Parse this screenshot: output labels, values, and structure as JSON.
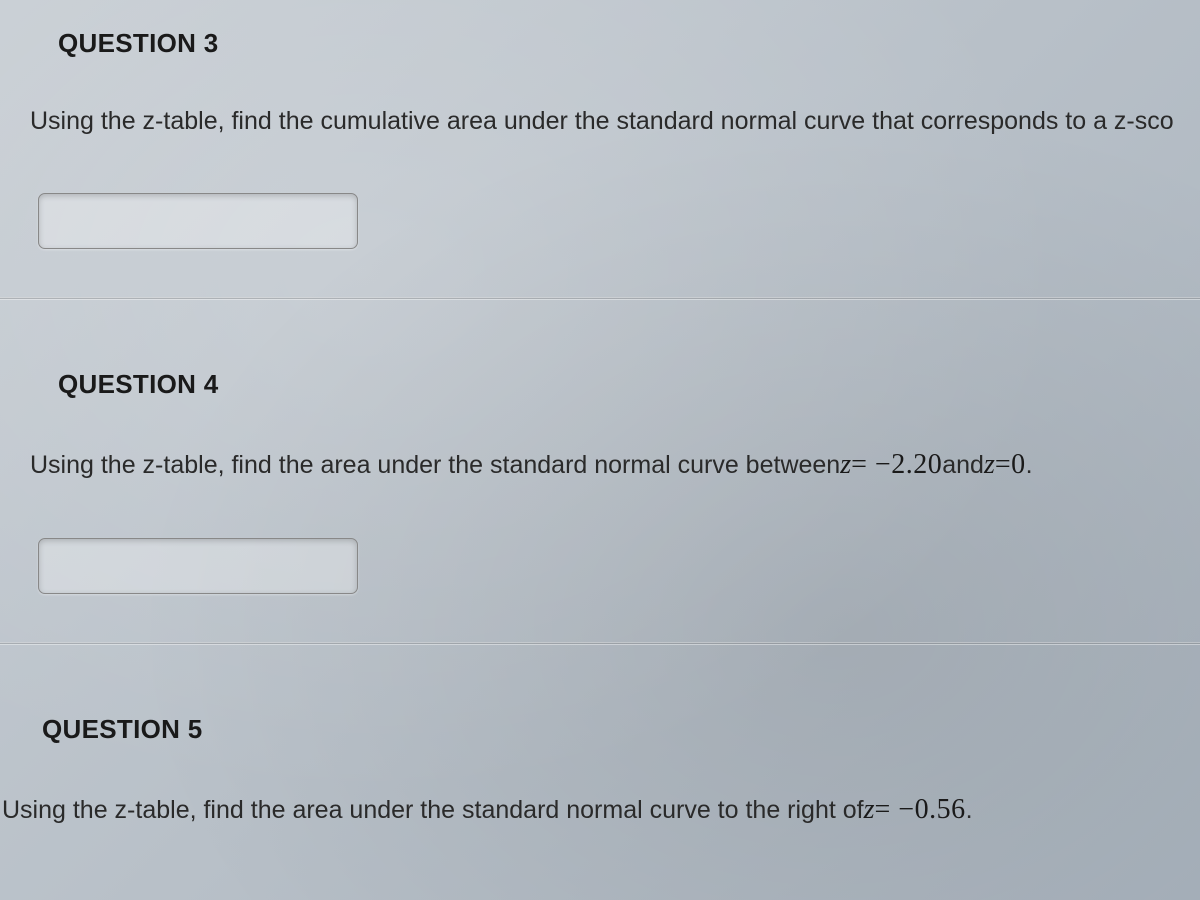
{
  "questions": [
    {
      "title": "QUESTION 3",
      "prompt_prefix": "Using the z-table, find the cumulative area under the standard normal curve that corresponds to a z-sco",
      "has_input": true
    },
    {
      "title": "QUESTION 4",
      "prompt_prefix": "Using the z-table, find the area under the standard normal curve between ",
      "eq1_var": "z",
      "eq1_op": "= −",
      "eq1_val": "2.20",
      "connector": " and ",
      "eq2_var": "z",
      "eq2_op": "=",
      "eq2_val": "0",
      "suffix": ".",
      "has_input": true
    },
    {
      "title": "QUESTION 5",
      "prompt_prefix": "Using the z-table, find the area under the standard normal curve to the right of ",
      "eq1_var": "z",
      "eq1_op": "= −",
      "eq1_val": "0.56",
      "suffix": ".",
      "has_input": false
    }
  ]
}
